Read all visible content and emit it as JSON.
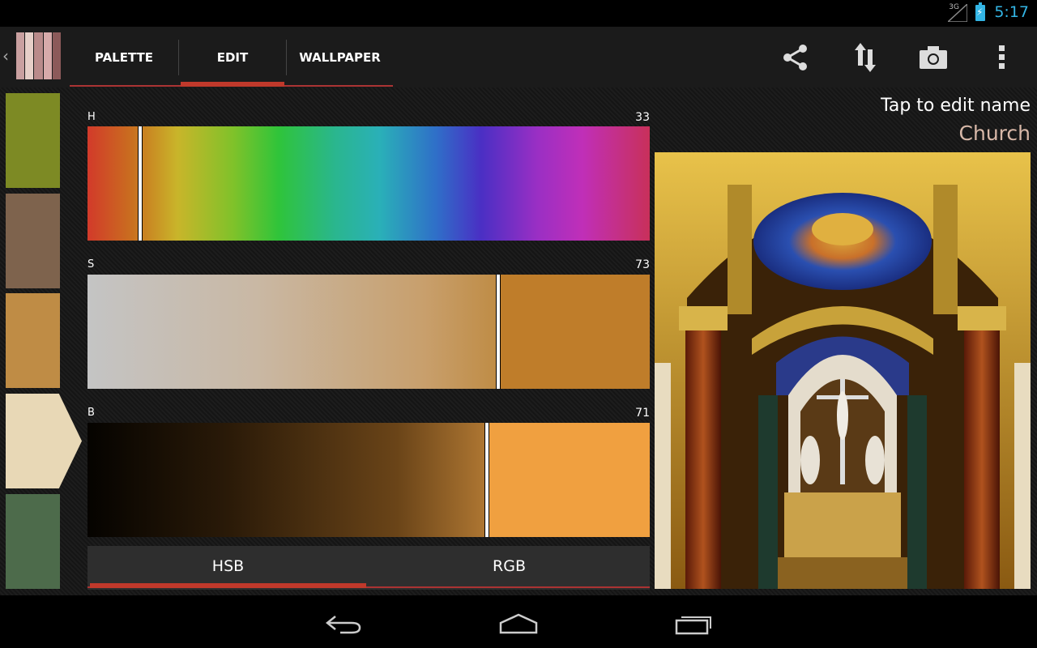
{
  "status_bar": {
    "network": "3G",
    "time": "5:17"
  },
  "app_icon": {
    "colors": [
      "#c9a0a0",
      "#e6cfc8",
      "#b98a8a",
      "#d7aaaa",
      "#8c5a5a"
    ]
  },
  "tabs": [
    {
      "label": "PALETTE",
      "selected": false
    },
    {
      "label": "EDIT",
      "selected": true
    },
    {
      "label": "WALLPAPER",
      "selected": false
    }
  ],
  "action_icons": [
    "share-icon",
    "sort-icon",
    "camera-icon",
    "overflow-menu-icon"
  ],
  "swatches": [
    {
      "color": "#7d8a24",
      "selected": false
    },
    {
      "color": "#7e634d",
      "selected": false
    },
    {
      "color": "#bf8c45",
      "selected": true
    },
    {
      "color": "#e8d8b6",
      "selected": false
    },
    {
      "color": "#4d6b4b",
      "selected": false
    }
  ],
  "channels": {
    "h": {
      "label": "H",
      "value": "33",
      "position": 0.093
    },
    "s": {
      "label": "S",
      "value": "73",
      "position": 0.73,
      "fill": "#bf7d2a"
    },
    "b": {
      "label": "B",
      "value": "71",
      "position": 0.71,
      "fill": "#f0a040"
    }
  },
  "modes": [
    {
      "label": "HSB",
      "selected": true
    },
    {
      "label": "RGB",
      "selected": false
    }
  ],
  "palette": {
    "hint": "Tap to edit name",
    "name": "Church"
  },
  "colors": {
    "accent": "#c0392b",
    "clock": "#33b5e5"
  }
}
